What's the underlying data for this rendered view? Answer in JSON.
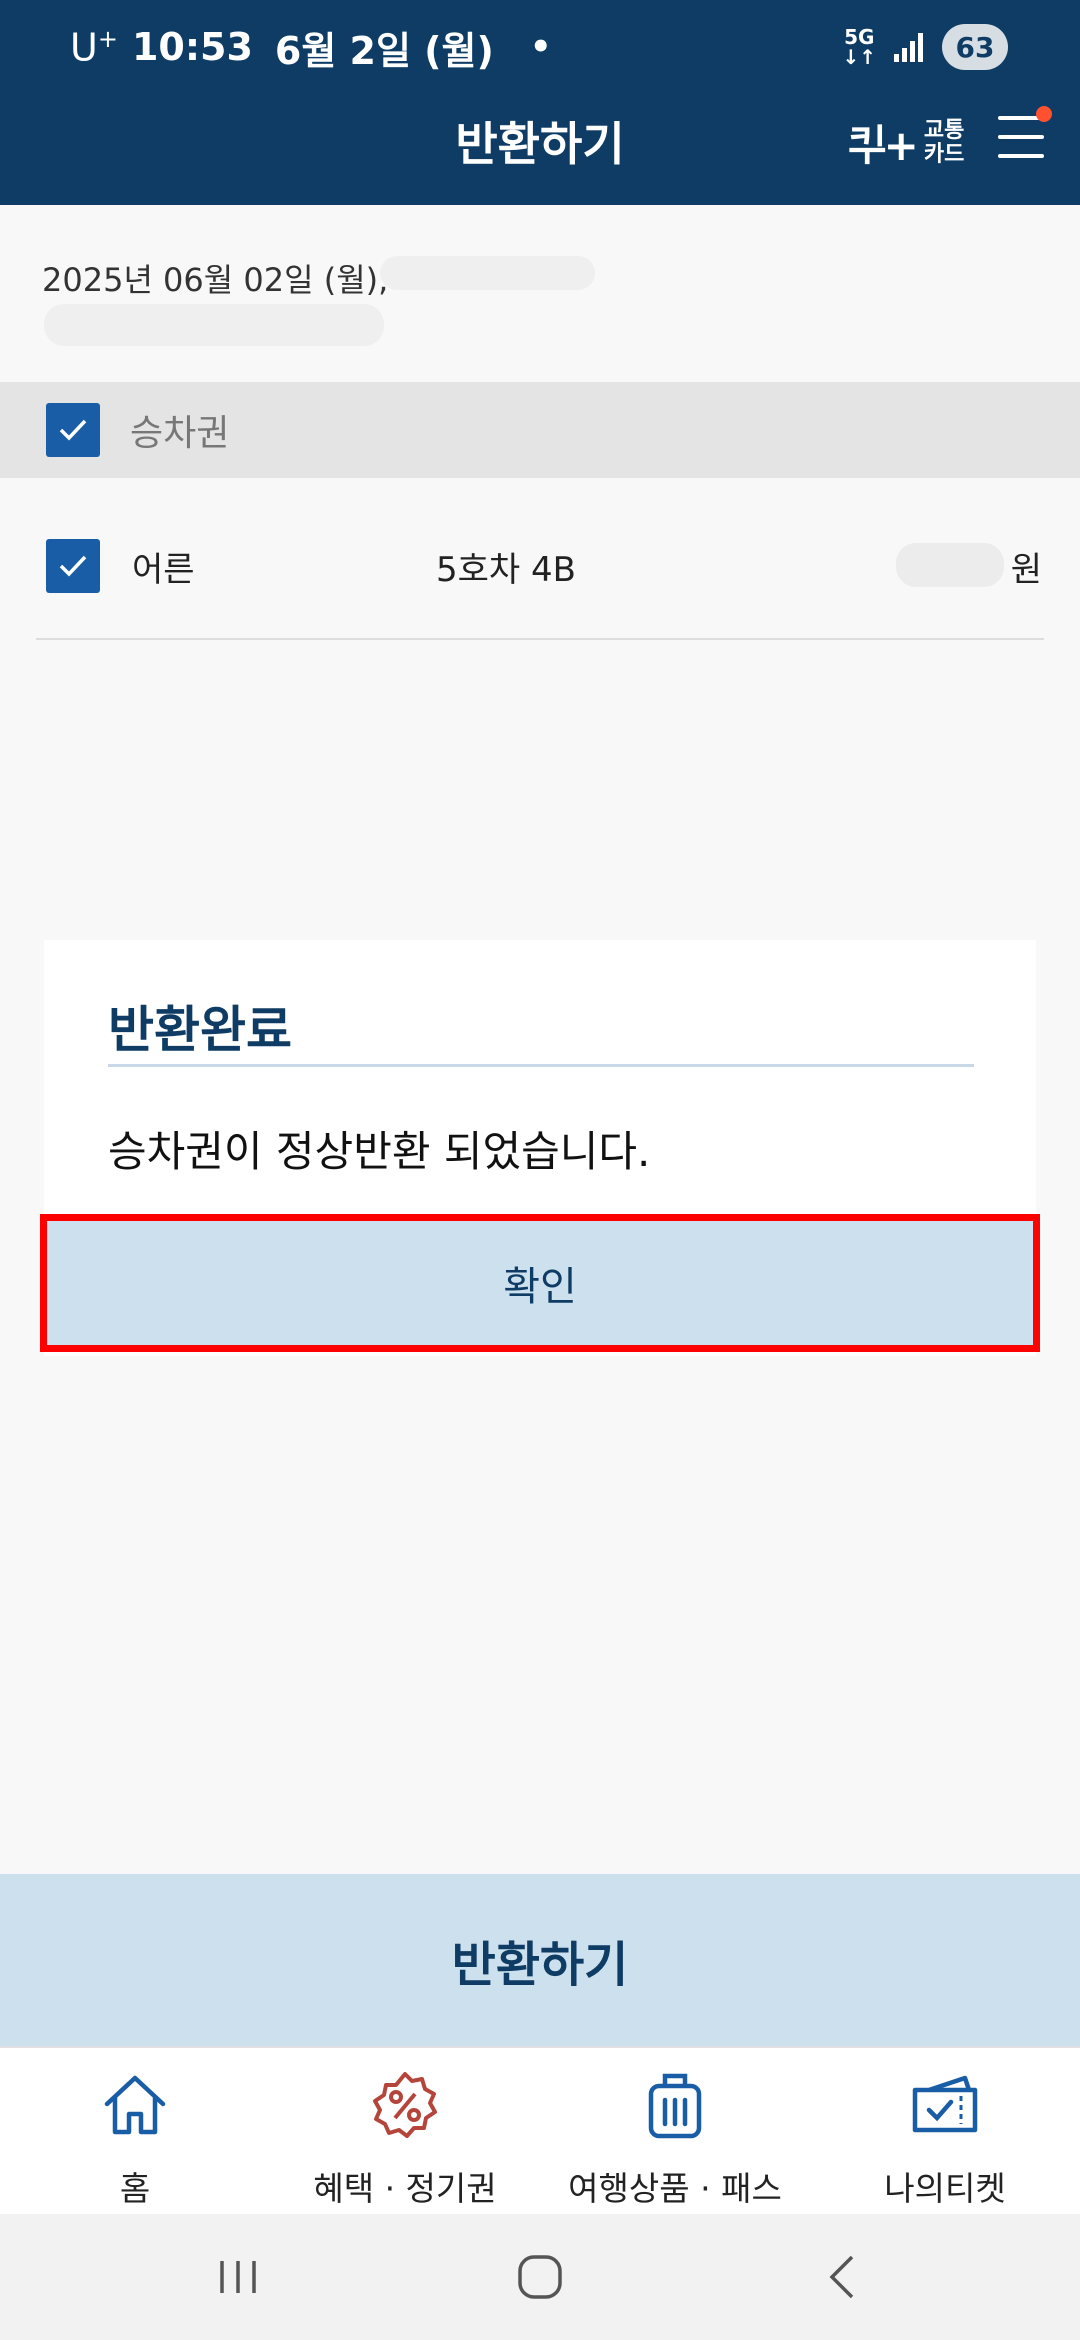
{
  "status_bar": {
    "carrier": "U",
    "carrier_sup": "+",
    "time": "10:53",
    "date": "6월 2일 (월)",
    "dot": "•",
    "network": "5G",
    "battery": "63"
  },
  "header": {
    "title": "반환하기",
    "card_logo_mark": "ᄏᆛ+",
    "card_logo_line1": "교통",
    "card_logo_line2": "카드"
  },
  "trip": {
    "date": "2025년 06월 02일 (월),"
  },
  "section": {
    "label": "승차권"
  },
  "ticket": {
    "type": "어른",
    "seat": "5호차 4B",
    "currency": "원"
  },
  "dialog": {
    "title": "반환완료",
    "message": "승차권이 정상반환 되었습니다.",
    "confirm_label": "확인"
  },
  "return_button": {
    "label": "반환하기"
  },
  "tabs": [
    {
      "label": "홈",
      "icon": "home-icon"
    },
    {
      "label": "혜택 · 정기권",
      "icon": "discount-icon"
    },
    {
      "label": "여행상품 · 패스",
      "icon": "luggage-icon"
    },
    {
      "label": "나의티켓",
      "icon": "ticket-icon"
    }
  ],
  "colors": {
    "header_bg": "#0e3c64",
    "accent": "#1a5da7",
    "button_bg": "#cde0ee",
    "highlight": "#ff0000",
    "discount_icon": "#b5453a"
  }
}
